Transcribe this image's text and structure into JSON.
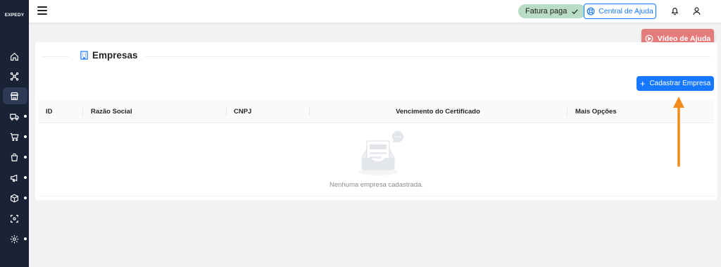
{
  "app": {
    "logo_text": "EXPEDY"
  },
  "sidebar": {
    "items": [
      {
        "name": "home",
        "icon": "home-icon",
        "has_dot": false,
        "active": false
      },
      {
        "name": "integrations",
        "icon": "hub-icon",
        "has_dot": false,
        "active": false
      },
      {
        "name": "stores",
        "icon": "store-icon",
        "has_dot": false,
        "active": true
      },
      {
        "name": "delivery",
        "icon": "truck-icon",
        "has_dot": true,
        "active": false
      },
      {
        "name": "cart",
        "icon": "cart-icon",
        "has_dot": true,
        "active": false
      },
      {
        "name": "bag",
        "icon": "bag-icon",
        "has_dot": true,
        "active": false
      },
      {
        "name": "marketing",
        "icon": "megaphone-icon",
        "has_dot": true,
        "active": false
      },
      {
        "name": "products",
        "icon": "box-icon",
        "has_dot": true,
        "active": false
      },
      {
        "name": "scan",
        "icon": "scan-icon",
        "has_dot": false,
        "active": false
      },
      {
        "name": "settings",
        "icon": "gear-icon",
        "has_dot": true,
        "active": false
      }
    ]
  },
  "header": {
    "payment_status": "Fatura paga",
    "help_center_label": "Central de Ajuda"
  },
  "video_help_label": "Vídeo de Ajuda",
  "page": {
    "title": "Empresas",
    "add_button_label": "Cadastrar Empresa"
  },
  "table": {
    "columns": [
      "ID",
      "Razão Social",
      "CNPJ",
      "Vencimento do Certificado",
      "Mais Opções"
    ],
    "rows": [],
    "empty_text": "Nenhuma empresa cadastrada."
  },
  "colors": {
    "sidebar_bg": "#1a2236",
    "primary": "#1677ff",
    "video_button": "#e57c7c",
    "paid_badge": "#b9dcc6",
    "annotation_arrow": "#f28a1c"
  }
}
